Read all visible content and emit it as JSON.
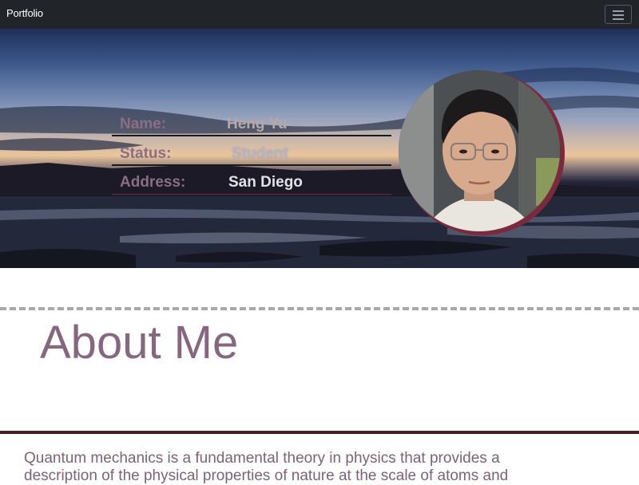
{
  "navbar": {
    "brand": "Portfolio",
    "toggler_icon": "hamburger-menu-icon"
  },
  "profile": {
    "fields": [
      {
        "label": "Name:",
        "value": "Heng Yu"
      },
      {
        "label": "Status:",
        "value": "Student"
      },
      {
        "label": "Address:",
        "value": "San Diego"
      }
    ]
  },
  "about": {
    "title": "About Me",
    "text": "Quantum mechanics is a fundamental theory in physics that provides a description of the physical properties of nature at the scale of atoms and"
  },
  "colors": {
    "navbar_bg": "#212529",
    "accent_mauve": "#85687f",
    "maroon": "#4b1c22",
    "dashed_rule": "#a9a9a9"
  }
}
